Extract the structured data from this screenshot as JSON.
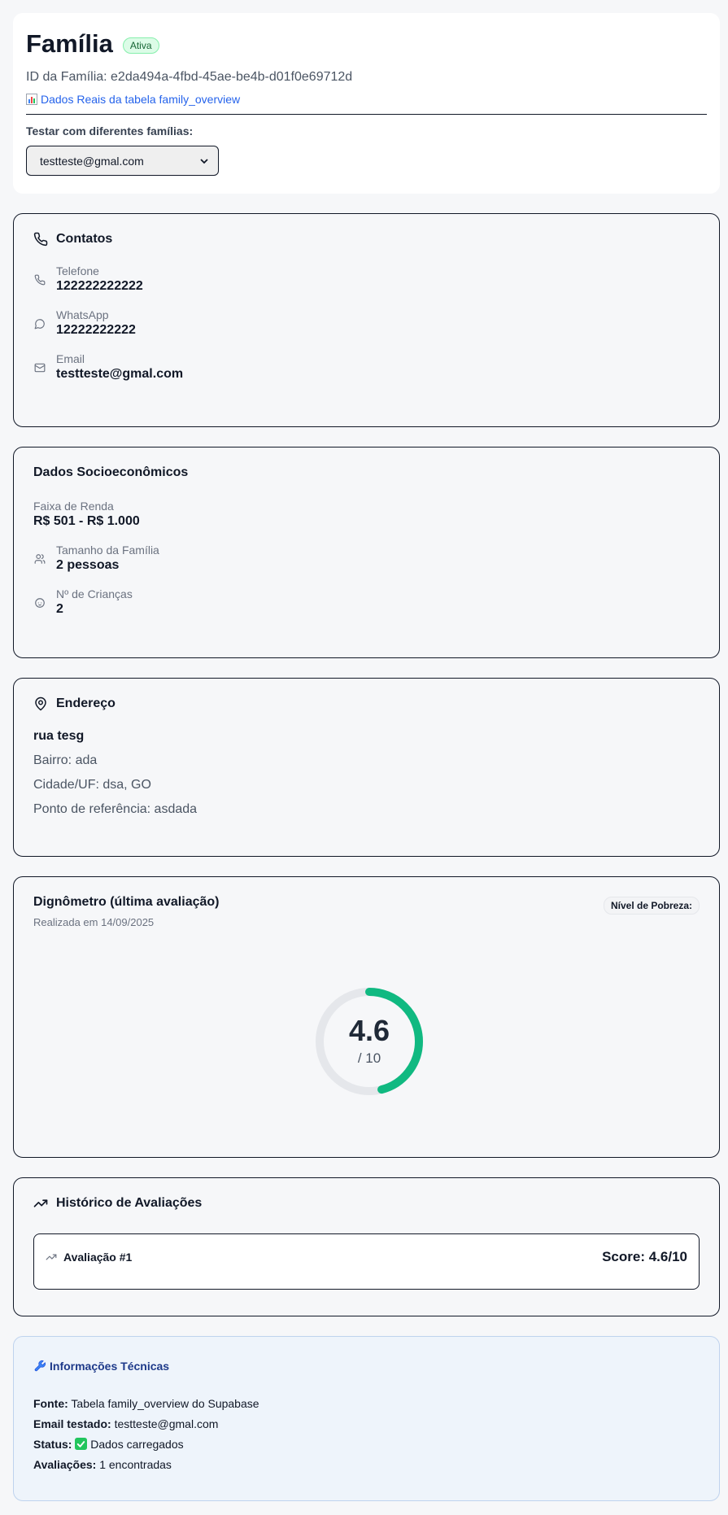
{
  "header": {
    "title": "Família",
    "status_badge": "Ativa",
    "family_id": "ID da Família: e2da494a-4fbd-45ae-be4b-d01f0e69712d",
    "source_link": "Dados Reais da tabela family_overview",
    "source_icon": "chart-emoji",
    "test_label": "Testar com diferentes famílias:",
    "select_value": "testteste@gmal.com"
  },
  "contacts": {
    "title": "Contatos",
    "items": [
      {
        "label": "Telefone",
        "value": "122222222222",
        "icon": "phone-icon"
      },
      {
        "label": "WhatsApp",
        "value": "12222222222",
        "icon": "message-circle-icon"
      },
      {
        "label": "Email",
        "value": "testteste@gmal.com",
        "icon": "mail-icon"
      }
    ]
  },
  "socio": {
    "title": "Dados Socioeconômicos",
    "income_label": "Faixa de Renda",
    "income_value": "R$ 501 - R$ 1.000",
    "family_size_label": "Tamanho da Família",
    "family_size_value": "2 pessoas",
    "children_label": "Nº de Crianças",
    "children_value": "2"
  },
  "address": {
    "title": "Endereço",
    "street": "rua tesg",
    "neighborhood": "Bairro: ada",
    "city": "Cidade/UF: dsa, GO",
    "reference": "Ponto de referência: asdada"
  },
  "dignometer": {
    "title": "Dignômetro (última avaliação)",
    "subtitle": "Realizada em 14/09/2025",
    "poverty_label": "Nível de Pobreza:",
    "score": "4.6",
    "score_value": 4.6,
    "score_max": 10,
    "score_den": "/ 10",
    "color": "#10b981",
    "track_color": "#e5e7eb"
  },
  "history": {
    "title": "Histórico de Avaliações",
    "items": [
      {
        "label": "Avaliação #1",
        "score": "Score: 4.6/10"
      }
    ]
  },
  "tech": {
    "title": "Informações Técnicas",
    "title_icon": "wrench-emoji",
    "source_key": "Fonte:",
    "source_val": "Tabela family_overview do Supabase",
    "email_key": "Email testado:",
    "email_val": "testteste@gmal.com",
    "status_key": "Status:",
    "status_val": "Dados carregados",
    "status_icon": "check-emoji",
    "evals_key": "Avaliações:",
    "evals_val": "1 encontradas"
  }
}
